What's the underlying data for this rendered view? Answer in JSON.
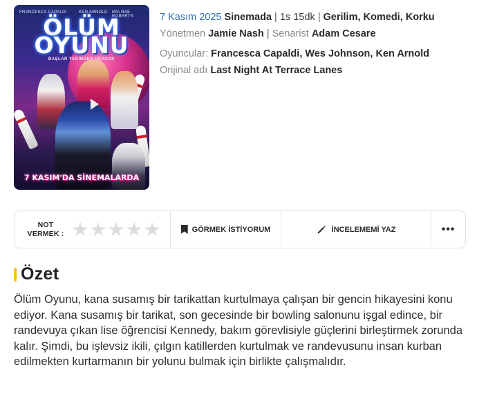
{
  "poster": {
    "credits": [
      "FRANCESCA CAPALDI",
      "KEN ARNOLD",
      "MIA RAE ROBERTS"
    ],
    "title_line1": "ÖLÜM",
    "title_line2": "OYUNU",
    "tagline": "BAŞLAR YERİNDEN UÇACAK",
    "release_text": "7 KASIM'DA SİNEMALARDA"
  },
  "info": {
    "release_date": "7 Kasım 2025",
    "release_where": "Sinemada",
    "duration": "1s 15dk",
    "genres": [
      "Gerilim",
      "Komedi",
      "Korku"
    ],
    "director_label": "Yönetmen",
    "director": "Jamie Nash",
    "writer_label": "Senarist",
    "writer": "Adam Cesare",
    "cast_label": "Oyuncular:",
    "cast": [
      "Francesca Capaldi",
      "Wes Johnson",
      "Ken Arnold"
    ],
    "original_title_label": "Orijinal adı",
    "original_title": "Last Night At Terrace Lanes"
  },
  "actions": {
    "rate_label_line1": "NOT",
    "rate_label_line2": "VERMEK :",
    "rating_value": 0,
    "rating_max": 5,
    "watchlist_label": "GÖRMEK İSTİYORUM",
    "review_label": "İNCELEMEMİ YAZ",
    "more_label": "•••"
  },
  "summary": {
    "heading": "Özet",
    "text": "Ölüm Oyunu, kana susamış bir tarikattan kurtulmaya çalışan bir gencin hikayesini konu ediyor. Kana susamış bir tarikat, son gecesinde bir bowling salonunu işgal edince, bir randevuya çıkan lise öğrencisi Kennedy, bakım görevlisiyle güçlerini birleştirmek zorunda kalır. Şimdi, bu işlevsiz ikili, çılgın katillerden kurtulmak ve randevusunu insan kurban edilmekten kurtarmanın bir yolunu bulmak için birlikte çalışmalıdır."
  },
  "colors": {
    "accent_blue": "#2f6fb2",
    "accent_yellow": "#f6c21c",
    "star_empty": "#dcdcdc"
  }
}
